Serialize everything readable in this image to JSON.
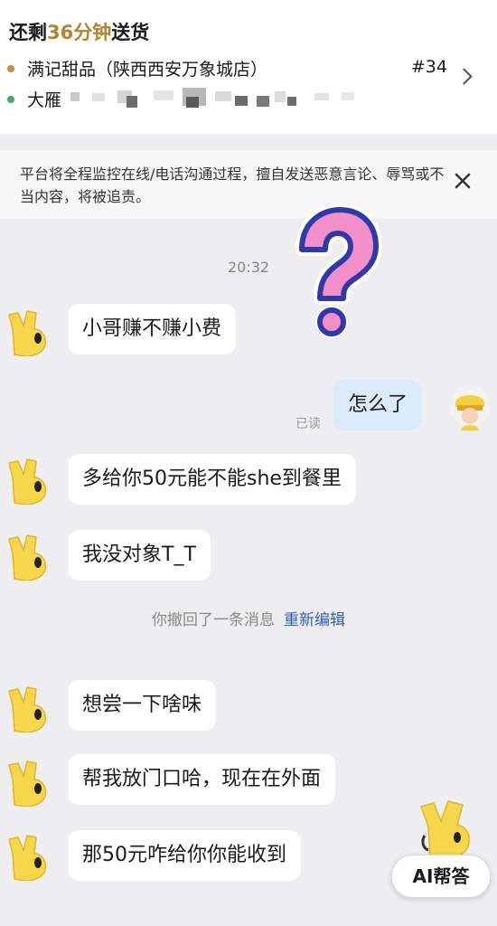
{
  "header": {
    "eta_prefix": "还剩",
    "eta_minutes": "36分钟",
    "eta_suffix": "送货",
    "store": "满记甜品（陕西西安万象城店）",
    "order_no": "#34",
    "address_visible": "大雁",
    "store_dot_color": "#d58a3c",
    "address_dot_color": "#3fae62"
  },
  "notice": {
    "text": "平台将全程监控在线/电话沟通过程，擅自发送恶意言论、辱骂或不当内容，将被追责。"
  },
  "chat": {
    "timestamp": "20:32",
    "read_status": "已读",
    "messages": [
      {
        "sender": "courier",
        "text": "小哥赚不赚小费"
      },
      {
        "sender": "me",
        "text": "怎么了"
      },
      {
        "sender": "courier",
        "text": "多给你50元能不能she到餐里"
      },
      {
        "sender": "courier",
        "text": "我没对象T_T"
      },
      {
        "sender": "courier",
        "text": "想尝一下啥味"
      },
      {
        "sender": "courier",
        "text": "帮我放门口哈，现在在外面"
      },
      {
        "sender": "courier",
        "text": "那50元咋给你你能收到"
      }
    ],
    "recall_text": "你撤回了一条消息",
    "recall_edit": "重新编辑"
  },
  "ai_button": {
    "label": "AI帮答"
  },
  "colors": {
    "accent_gold": "#b5832b",
    "my_bubble": "#dcebfc",
    "link_blue": "#2d5fb8",
    "mascot_yellow": "#f6d64a"
  }
}
